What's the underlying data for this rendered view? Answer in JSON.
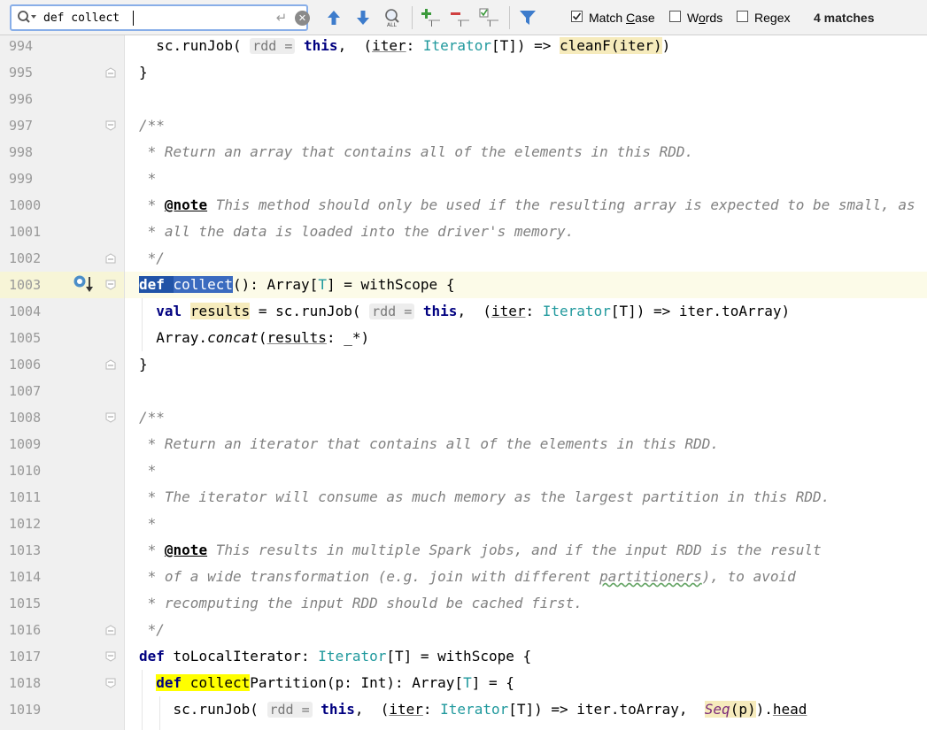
{
  "search": {
    "query": "def collect",
    "placeholder": "",
    "options": {
      "match_case": {
        "label_pre": "Match ",
        "label_ul": "C",
        "label_post": "ase",
        "checked": true
      },
      "words": {
        "label_pre": "W",
        "label_ul": "o",
        "label_post": "rds",
        "checked": false
      },
      "regex": {
        "label_pre": "Re",
        "label_ul": "g",
        "label_post": "ex",
        "checked": false
      }
    },
    "matches_label": "4 matches"
  },
  "toolbar_icons": [
    "search-icon",
    "enter-icon",
    "clear-icon",
    "previous-occurrence-icon",
    "next-occurrence-icon",
    "select-all-occurrences-icon",
    "add-selection-icon",
    "remove-selection-icon",
    "toggle-selection-icon",
    "filter-icon"
  ],
  "editor": {
    "line_numbers": [
      "994",
      "995",
      "996",
      "997",
      "998",
      "999",
      "1000",
      "1001",
      "1002",
      "1003",
      "1004",
      "1005",
      "1006",
      "1007",
      "1008",
      "1009",
      "1010",
      "1011",
      "1012",
      "1013",
      "1014",
      "1015",
      "1016",
      "1017",
      "1018",
      "1019"
    ],
    "current_line": "1003",
    "code": {
      "l994": {
        "a": "  sc.runJob( ",
        "hint": "rdd =",
        "b": " this",
        "c": ",  (",
        "d": "iter",
        "e": ": ",
        "f": "Iterator",
        "g": "[T]) => ",
        "h": "cleanF(iter)",
        "i": ")"
      },
      "l995": "}",
      "l997": "/**",
      "l998": " * Return an array that contains all of the elements in this RDD.",
      "l999": " *",
      "l1000": {
        "a": " * ",
        "tag": "@note",
        "b": " This method should only be used if the resulting array is expected to be small, as"
      },
      "l1001": " * all the data is loaded into the driver's memory.",
      "l1002": " */",
      "l1003": {
        "kw": "def",
        "sp": " ",
        "name": "collect",
        "rest": "(): Array[",
        "t": "T",
        "rest2": "] = withScope {"
      },
      "l1004": {
        "a": "  ",
        "kw": "val",
        "sp": " ",
        "v": "results",
        "b": " = sc.runJob( ",
        "hint": "rdd =",
        "c": " ",
        "kw2": "this",
        "d": ",  (",
        "e": "iter",
        "f": ": ",
        "g": "Iterator",
        "h": "[T]) => iter.toArray)"
      },
      "l1005": {
        "a": "  Array.",
        "b": "concat",
        "c": "(",
        "d": "results",
        "e": ": _*)"
      },
      "l1006": "}",
      "l1008": "/**",
      "l1009": " * Return an iterator that contains all of the elements in this RDD.",
      "l1010": " *",
      "l1011": " * The iterator will consume as much memory as the largest partition in this RDD.",
      "l1012": " *",
      "l1013": {
        "a": " * ",
        "tag": "@note",
        "b": " This results in multiple Spark jobs, and if the input RDD is the result"
      },
      "l1014": {
        "a": " * of a wide transformation (e.g. join with different ",
        "ul": "partitioners",
        "b": "), to avoid"
      },
      "l1015": " * recomputing the input RDD should be cached first.",
      "l1016": " */",
      "l1017": {
        "kw": "def",
        "a": " toLocalIterator: ",
        "t": "Iterator",
        "b": "[T] = withScope {"
      },
      "l1018": {
        "a": "  ",
        "m1": "def",
        "m2": " collect",
        "b": "Partition(p: Int): Array[",
        "t": "T",
        "c": "] = {"
      },
      "l1019": {
        "a": "    sc.runJob( ",
        "hint": "rdd =",
        "b": " ",
        "kw": "this",
        "c": ",  (",
        "d": "iter",
        "e": ": ",
        "f": "Iterator",
        "g": "[T]) => iter.toArray,  ",
        "seq": "Seq",
        "h": "(p)",
        "i": ").",
        "j": "head"
      }
    }
  },
  "colors": {
    "keyword": "#000080",
    "comment": "#808080",
    "type": "#20999d",
    "selection": "#2153a7",
    "match": "#ffff00",
    "current_line": "#fcfbe8"
  }
}
